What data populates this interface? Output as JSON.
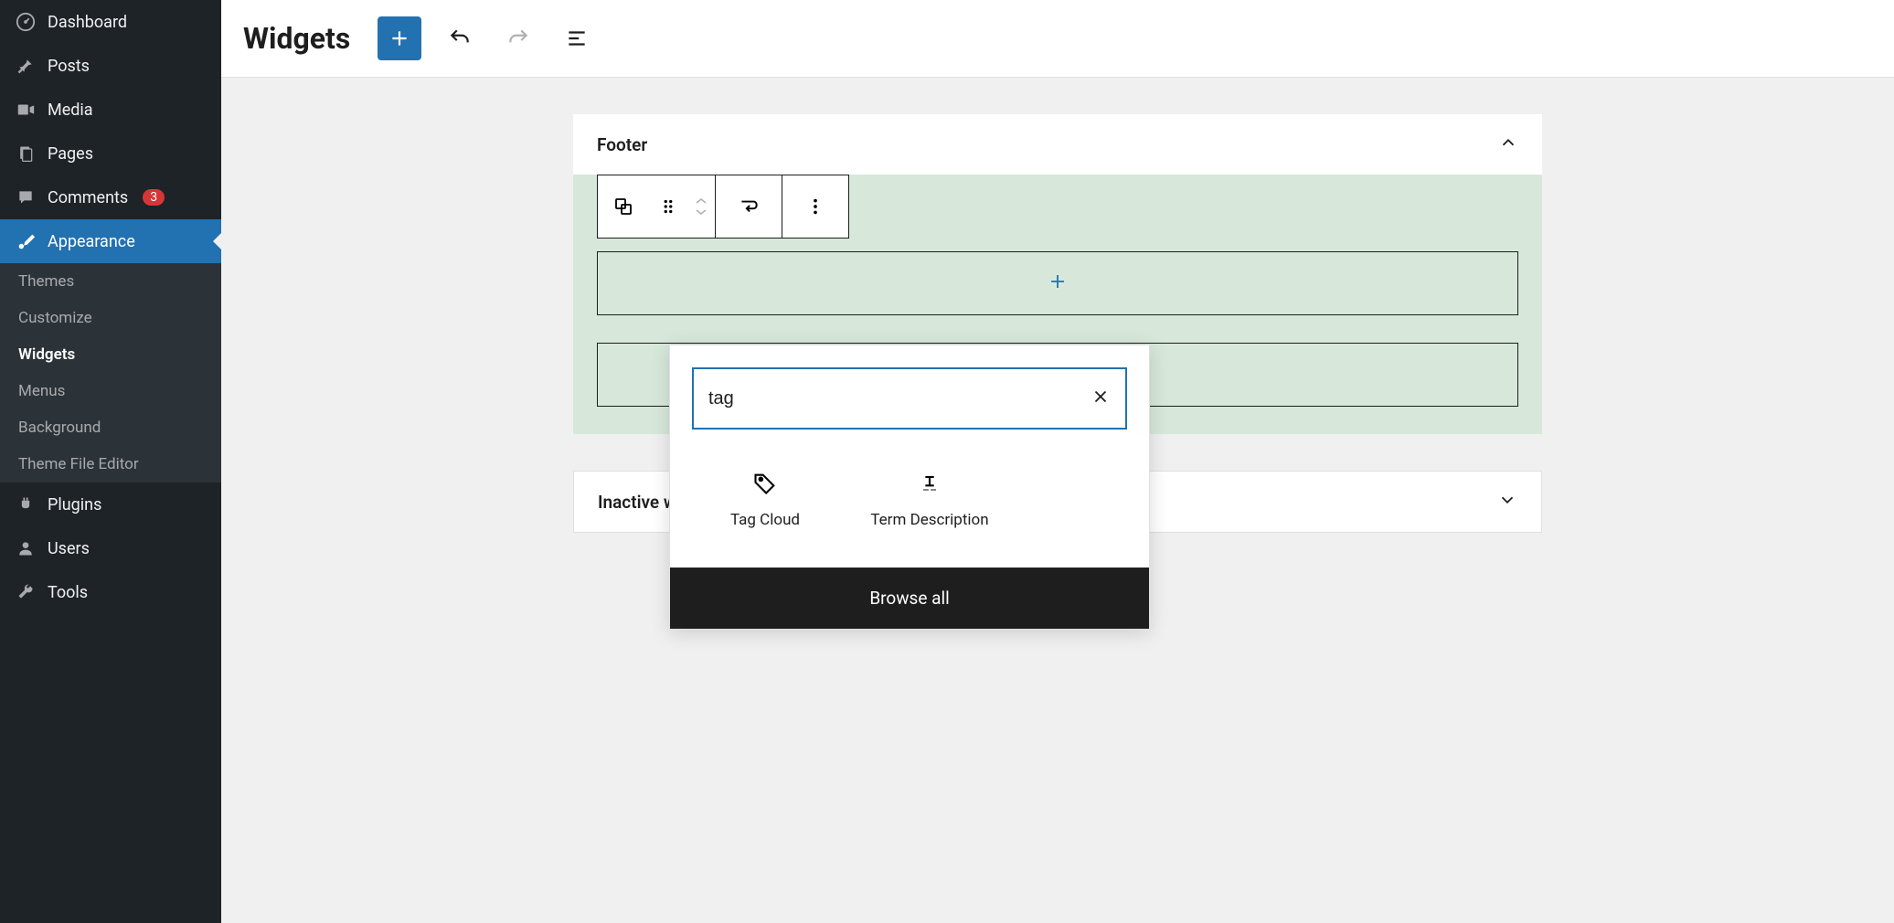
{
  "sidebar": {
    "items": [
      {
        "label": "Dashboard",
        "icon": "dashboard"
      },
      {
        "label": "Posts",
        "icon": "pin"
      },
      {
        "label": "Media",
        "icon": "media"
      },
      {
        "label": "Pages",
        "icon": "pages"
      },
      {
        "label": "Comments",
        "icon": "comment",
        "badge": "3"
      },
      {
        "label": "Appearance",
        "icon": "brush",
        "active": true
      },
      {
        "label": "Plugins",
        "icon": "plug"
      },
      {
        "label": "Users",
        "icon": "user"
      },
      {
        "label": "Tools",
        "icon": "wrench"
      }
    ],
    "submenu": [
      {
        "label": "Themes"
      },
      {
        "label": "Customize"
      },
      {
        "label": "Widgets",
        "current": true
      },
      {
        "label": "Menus"
      },
      {
        "label": "Background"
      },
      {
        "label": "Theme File Editor"
      }
    ]
  },
  "topbar": {
    "title": "Widgets"
  },
  "areas": {
    "footer_title": "Footer",
    "inactive_title": "Inactive widgets"
  },
  "inserter": {
    "search_value": "tag",
    "results": [
      {
        "label": "Tag Cloud",
        "icon": "tag"
      },
      {
        "label": "Term Description",
        "icon": "term"
      }
    ],
    "browse_all": "Browse all"
  }
}
